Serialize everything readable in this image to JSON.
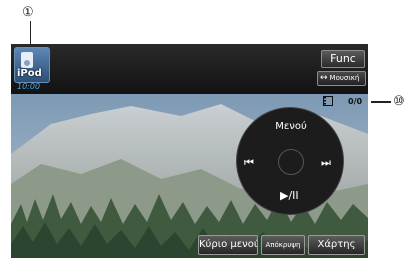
{
  "callouts": {
    "first": "①",
    "tenth": "⑩"
  },
  "topbar": {
    "source": {
      "label": "iPod",
      "icon": "ipod-icon"
    },
    "clock": "10:00",
    "func_label": "Func",
    "music_toggle": {
      "arrow": "↔",
      "label": "Μουσική"
    }
  },
  "status": {
    "film_icon": "film-strip-icon",
    "track_counter": "0/0"
  },
  "controls": {
    "menu_label": "Μενού",
    "prev_glyph": "⏮",
    "next_glyph": "⏭",
    "playpause_glyph": "▶/II"
  },
  "softkeys": {
    "main_menu": "Κύριο μενού",
    "hide": "Απόκρυψη",
    "map": "Χάρτης"
  },
  "colors": {
    "clock_text": "#4aa9e6",
    "sky_top": "#7d99b3",
    "button_bg": "#3a3a3a"
  }
}
